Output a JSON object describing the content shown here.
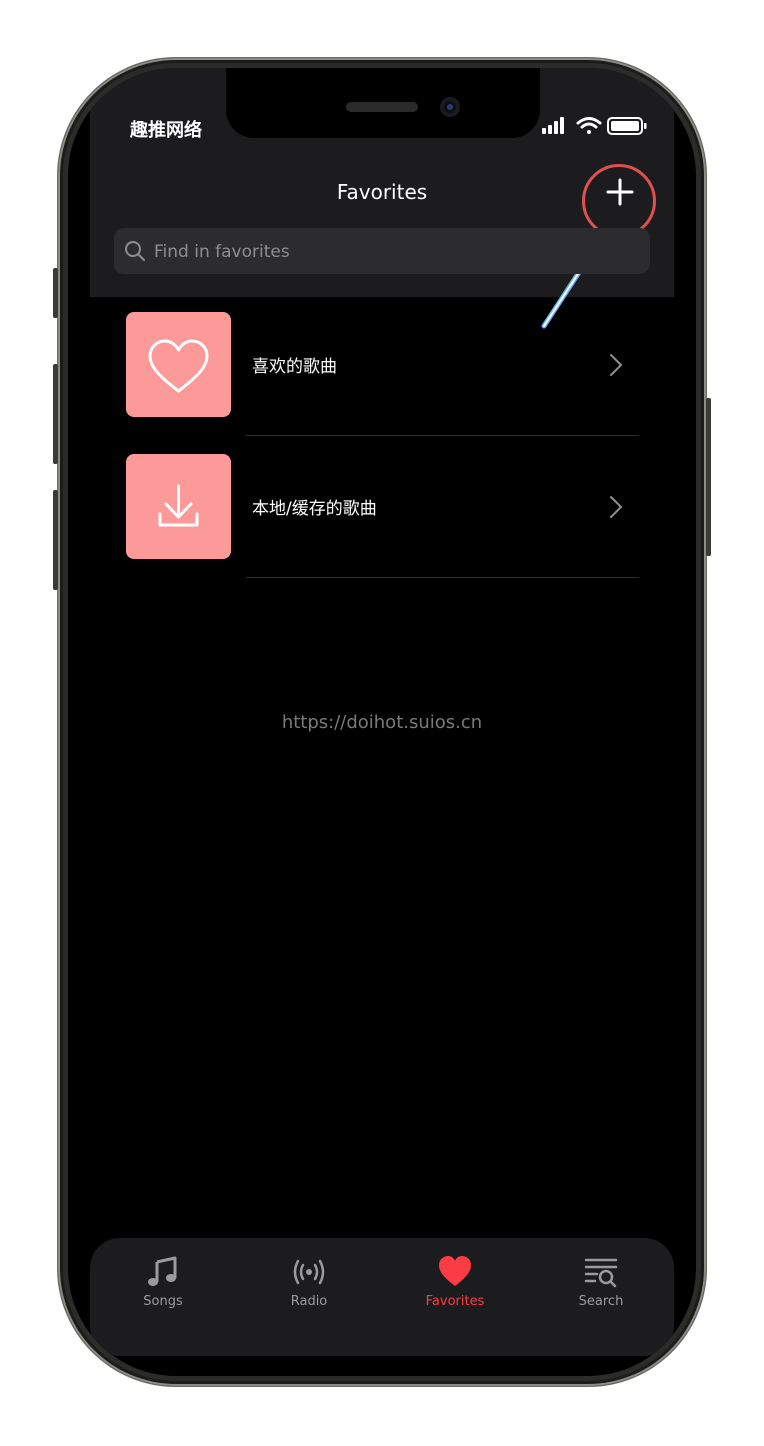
{
  "status_bar": {
    "carrier": "趣推网络"
  },
  "header": {
    "title": "Favorites"
  },
  "search": {
    "placeholder": "Find in favorites"
  },
  "list": [
    {
      "label": "喜欢的歌曲",
      "icon": "heart-icon"
    },
    {
      "label": "本地/缓存的歌曲",
      "icon": "download-icon"
    }
  ],
  "watermark": "https://doihot.suios.cn",
  "tabs": [
    {
      "label": "Songs",
      "icon": "music-note-icon",
      "active": false
    },
    {
      "label": "Radio",
      "icon": "radio-broadcast-icon",
      "active": false
    },
    {
      "label": "Favorites",
      "icon": "heart-icon",
      "active": true
    },
    {
      "label": "Search",
      "icon": "search-list-icon",
      "active": false
    }
  ],
  "colors": {
    "accent": "#fc3c44",
    "tile": "#fc9a9a",
    "annotation_circle": "#e05050",
    "annotation_arrow": "#6ab0f0"
  }
}
